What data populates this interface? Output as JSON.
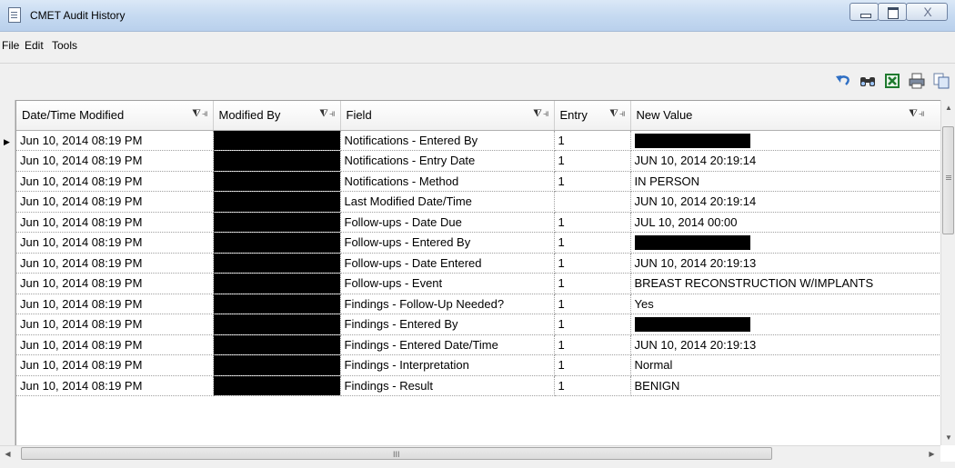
{
  "window": {
    "title": "CMET Audit History",
    "minimize": "minimize",
    "maximize": "maximize",
    "close_glyph": "X"
  },
  "menu": [
    "File",
    "Edit",
    "Tools"
  ],
  "toolbar": {
    "icons": [
      "undo-icon",
      "find-icon",
      "excel-export-icon",
      "print-icon",
      "copy-icon"
    ]
  },
  "table": {
    "columns": [
      "Date/Time Modified",
      "Modified By",
      "Field",
      "Entry",
      "New Value"
    ],
    "filter_glyph": "⧨⫣",
    "rows": [
      {
        "date": "Jun 10, 2014 08:19 PM",
        "modified_by": "",
        "field": "Notifications - Entered By",
        "entry": "1",
        "new_value": "",
        "new_value_redacted": true,
        "selected": true
      },
      {
        "date": "Jun 10, 2014 08:19 PM",
        "modified_by": "",
        "field": "Notifications - Entry Date",
        "entry": "1",
        "new_value": "JUN 10, 2014 20:19:14",
        "new_value_redacted": false
      },
      {
        "date": "Jun 10, 2014 08:19 PM",
        "modified_by": "",
        "field": "Notifications - Method",
        "entry": "1",
        "new_value": "IN PERSON",
        "new_value_redacted": false
      },
      {
        "date": "Jun 10, 2014 08:19 PM",
        "modified_by": "",
        "field": "Last Modified Date/Time",
        "entry": "",
        "new_value": "JUN 10, 2014 20:19:14",
        "new_value_redacted": false
      },
      {
        "date": "Jun 10, 2014 08:19 PM",
        "modified_by": "",
        "field": "Follow-ups - Date Due",
        "entry": "1",
        "new_value": "JUL 10, 2014 00:00",
        "new_value_redacted": false
      },
      {
        "date": "Jun 10, 2014 08:19 PM",
        "modified_by": "",
        "field": "Follow-ups - Entered By",
        "entry": "1",
        "new_value": "",
        "new_value_redacted": true
      },
      {
        "date": "Jun 10, 2014 08:19 PM",
        "modified_by": "",
        "field": "Follow-ups - Date Entered",
        "entry": "1",
        "new_value": "JUN 10, 2014 20:19:13",
        "new_value_redacted": false
      },
      {
        "date": "Jun 10, 2014 08:19 PM",
        "modified_by": "",
        "field": "Follow-ups - Event",
        "entry": "1",
        "new_value": "BREAST RECONSTRUCTION W/IMPLANTS",
        "new_value_redacted": false
      },
      {
        "date": "Jun 10, 2014 08:19 PM",
        "modified_by": "",
        "field": "Findings - Follow-Up Needed?",
        "entry": "1",
        "new_value": "Yes",
        "new_value_redacted": false
      },
      {
        "date": "Jun 10, 2014 08:19 PM",
        "modified_by": "",
        "field": "Findings - Entered By",
        "entry": "1",
        "new_value": "",
        "new_value_redacted": true
      },
      {
        "date": "Jun 10, 2014 08:19 PM",
        "modified_by": "",
        "field": "Findings - Entered Date/Time",
        "entry": "1",
        "new_value": "JUN 10, 2014 20:19:13",
        "new_value_redacted": false
      },
      {
        "date": "Jun 10, 2014 08:19 PM",
        "modified_by": "",
        "field": "Findings - Interpretation",
        "entry": "1",
        "new_value": "Normal",
        "new_value_redacted": false
      },
      {
        "date": "Jun 10, 2014 08:19 PM",
        "modified_by": "",
        "field": "Findings - Result",
        "entry": "1",
        "new_value": "BENIGN",
        "new_value_redacted": false
      }
    ]
  },
  "scrollbars": {
    "hscroll_grip": "III"
  }
}
